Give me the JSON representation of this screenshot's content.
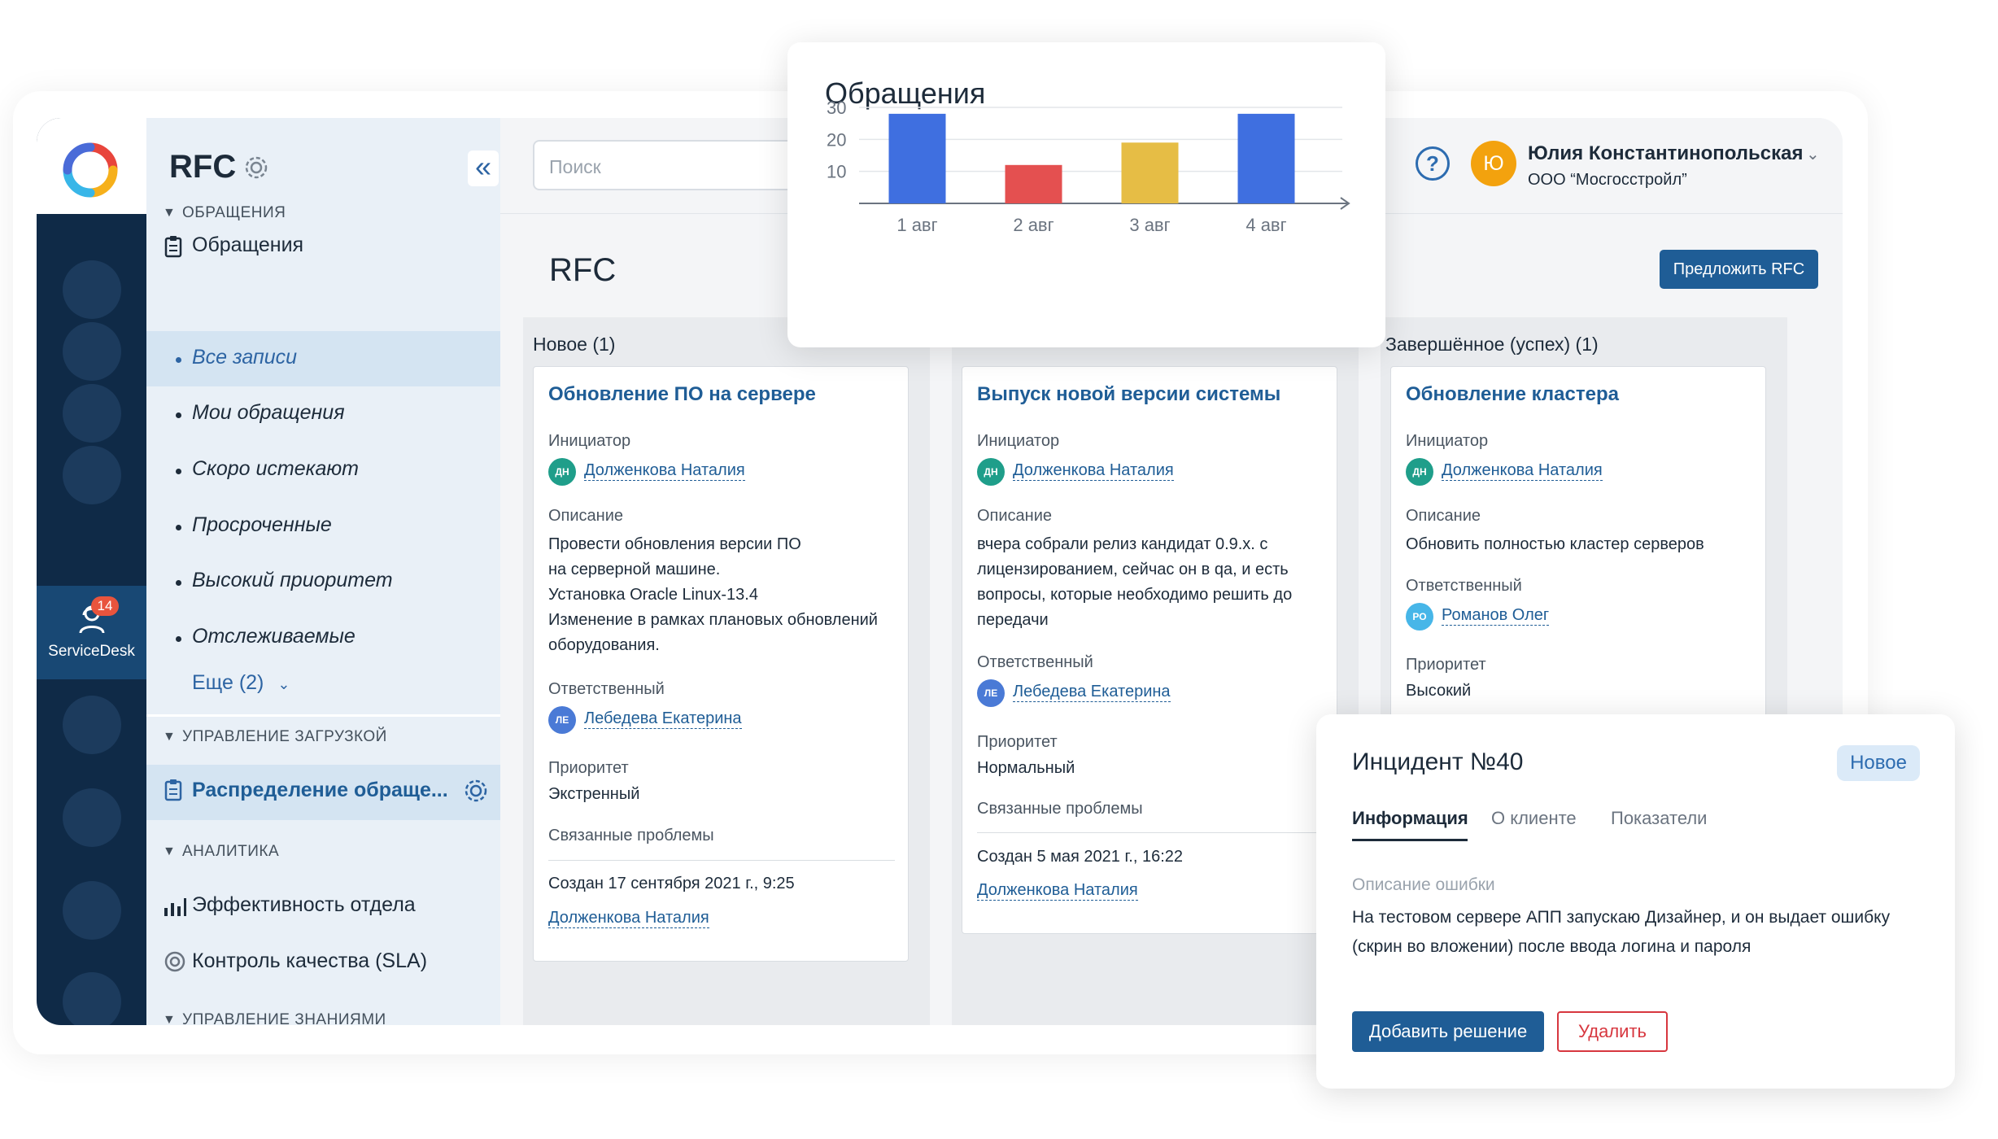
{
  "sidebar": {
    "title": "RFC",
    "collapse": "«",
    "sections": [
      {
        "title": "ОБРАЩЕНИЯ"
      },
      {
        "title": "УПРАВЛЕНИЕ ЗАГРУЗКОЙ"
      },
      {
        "title": "АНАЛИТИКА"
      },
      {
        "title": "УПРАВЛЕНИЕ ЗНАНИЯМИ"
      }
    ],
    "appeals": "Обращения",
    "items": [
      "Все записи",
      "Мои обращения",
      "Скоро истекают",
      "Просроченные",
      "Высокий приоритет",
      "Отслеживаемые"
    ],
    "more": "Еще (2)",
    "distribution": "Распределение обраще...",
    "efficiency": "Эффективность отдела",
    "sla": "Контроль качества (SLA)"
  },
  "rail": {
    "badge": "14",
    "label": "ServiceDesk"
  },
  "header": {
    "search_placeholder": "Поиск",
    "help": "?",
    "user_initial": "Ю",
    "user_name": "Юлия Константинопольская",
    "user_org": "ООО “Мосгосстройл”"
  },
  "main": {
    "title": "RFC",
    "propose_button": "Предложить RFC",
    "columns": [
      {
        "title": "Новое (1)",
        "card": {
          "title": "Обновление ПО на сервере",
          "initiator_label": "Инициатор",
          "initiator_initials": "ДН",
          "initiator": "Долженкова Наталия",
          "desc_label": "Описание",
          "desc": [
            "Провести обновления версии ПО",
            "на серверной машине.",
            "Установка Oracle Linux-13.4",
            "Изменение в рамках плановых обновлений",
            "оборудования."
          ],
          "resp_label": "Ответственный",
          "resp_initials": "ЛЕ",
          "resp": "Лебедева Екатерина",
          "prio_label": "Приоритет",
          "prio": "Экстренный",
          "rel_label": "Связанные проблемы",
          "created": "Создан 17 сентября 2021 г., 9:25",
          "creator": "Долженкова Наталия"
        }
      },
      {
        "title": "",
        "card": {
          "title": "Выпуск новой версии системы",
          "initiator_label": "Инициатор",
          "initiator_initials": "ДН",
          "initiator": "Долженкова Наталия",
          "desc_label": "Описание",
          "desc": [
            "вчера собрали релиз кандидат 0.9.х. с",
            "лицензированием, сейчас он в qa, и есть",
            "вопросы, которые необходимо решить до",
            "передачи"
          ],
          "resp_label": "Ответственный",
          "resp_initials": "ЛЕ",
          "resp": "Лебедева Екатерина",
          "prio_label": "Приоритет",
          "prio": "Нормальный",
          "rel_label": "Связанные проблемы",
          "created": "Создан 5 мая 2021 г., 16:22",
          "creator": "Долженкова Наталия"
        }
      },
      {
        "title": "Завершённое (успех) (1)",
        "card": {
          "title": "Обновление кластера",
          "initiator_label": "Инициатор",
          "initiator_initials": "ДН",
          "initiator": "Долженкова Наталия",
          "desc_label": "Описание",
          "desc": [
            "Обновить полностью кластер серверов"
          ],
          "resp_label": "Ответственный",
          "resp_initials": "РО",
          "resp": "Романов Олег",
          "prio_label": "Приоритет",
          "prio": "Высокий"
        }
      }
    ]
  },
  "chart_data": {
    "type": "bar",
    "title": "Обращения",
    "categories": [
      "1 авг",
      "2 авг",
      "3 авг",
      "4 авг"
    ],
    "values": [
      28,
      12,
      19,
      28
    ],
    "colors": [
      "#3f6fe0",
      "#e45050",
      "#e6bd45",
      "#3f6fe0"
    ],
    "ylim": [
      0,
      30
    ],
    "yticks": [
      10,
      20,
      30
    ],
    "grid": true
  },
  "incident": {
    "title": "Инцидент №40",
    "status": "Новое",
    "tabs": [
      "Информация",
      "О клиенте",
      "Показатели"
    ],
    "desc_label": "Описание ошибки",
    "desc": "На тестовом сервере АПП запускаю Дизайнер, и он выдает ошибку (скрин во вложении) после ввода логина и пароля",
    "add_button": "Добавить решение",
    "delete_button": "Удалить"
  }
}
